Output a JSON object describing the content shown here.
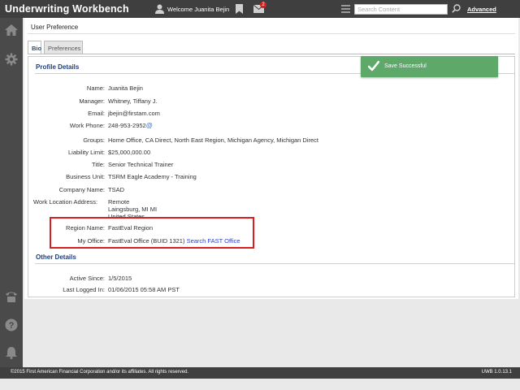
{
  "header": {
    "app_title": "Underwriting Workbench",
    "welcome_text": "Welcome Juanita Bejin",
    "notification_count": "2",
    "search_placeholder": "Search Content",
    "advanced_label": "Advanced"
  },
  "siderail": {
    "top_icons": [
      "home-icon",
      "gear-icon"
    ],
    "bottom_icons": [
      "phone-icon",
      "help-icon",
      "bell-icon"
    ]
  },
  "page": {
    "title": "User Preference",
    "tabs": [
      {
        "label": "Bio",
        "active": true
      },
      {
        "label": "Preferences",
        "active": false
      }
    ]
  },
  "toast": {
    "message": "Save Successful",
    "color": "#5ea86a"
  },
  "profile": {
    "section_title": "Profile Details",
    "fields": [
      {
        "label": "Name:",
        "value": "Juanita Bejin"
      },
      {
        "label": "Manager:",
        "value": "Whitney, Tiffany J."
      },
      {
        "label": "Email:",
        "value": "jbejin@firstam.com"
      },
      {
        "label": "Work Phone:",
        "value": "248-953-2952"
      },
      {
        "label": "Groups:",
        "value": "Home Office, CA Direct, North East Region, Michigan Agency, Michigan Direct"
      },
      {
        "label": "Liability Limit:",
        "value": "$25,000,000.00"
      },
      {
        "label": "Title:",
        "value": "Senior Technical Trainer"
      },
      {
        "label": "Business Unit:",
        "value": "TSRM Eagle Academy - Training"
      },
      {
        "label": "Company Name:",
        "value": "TSAD"
      }
    ],
    "work_location": {
      "label": "Work Location Address:",
      "line1": "Remote",
      "line2": "Laingsburg, MI MI",
      "line3": "United States"
    },
    "region": {
      "label": "Region Name:",
      "value": "FastEval Region"
    },
    "office": {
      "label": "My Office:",
      "value": "FastEval Office (BUID 1321)",
      "link": "Search FAST Office"
    }
  },
  "other": {
    "section_title": "Other Details",
    "fields": [
      {
        "label": "Active Since:",
        "value": "1/5/2015"
      },
      {
        "label": "Last Logged In:",
        "value": "01/06/2015 05:58 AM PST"
      }
    ]
  },
  "footer": {
    "copyright": "©2015 First American Financial Corporation and/or its affiliates. All rights reserved.",
    "version": "UWB 1.0.13.1"
  },
  "colors": {
    "topbar": "#3f3f3f",
    "section_title": "#1f3f7a",
    "link": "#2a3fcc",
    "highlight": "#d81e1e"
  }
}
